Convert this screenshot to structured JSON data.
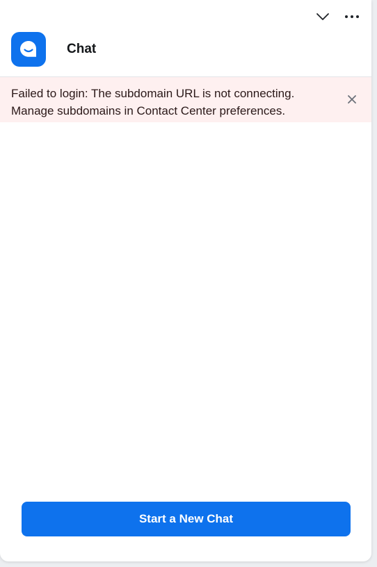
{
  "header": {
    "app_icon": "chat-bubble-icon",
    "title": "Chat",
    "controls": {
      "collapse_icon": "chevron-down-icon",
      "more_icon": "more-options-icon"
    }
  },
  "error_banner": {
    "line1": "Failed to login: The subdomain URL is not connecting.",
    "line2": "Manage subdomains in Contact Center preferences.",
    "close_icon": "close-icon",
    "background": "#fef0f0"
  },
  "actions": {
    "start_chat_label": "Start a New Chat"
  },
  "colors": {
    "accent": "#0e72ed"
  }
}
